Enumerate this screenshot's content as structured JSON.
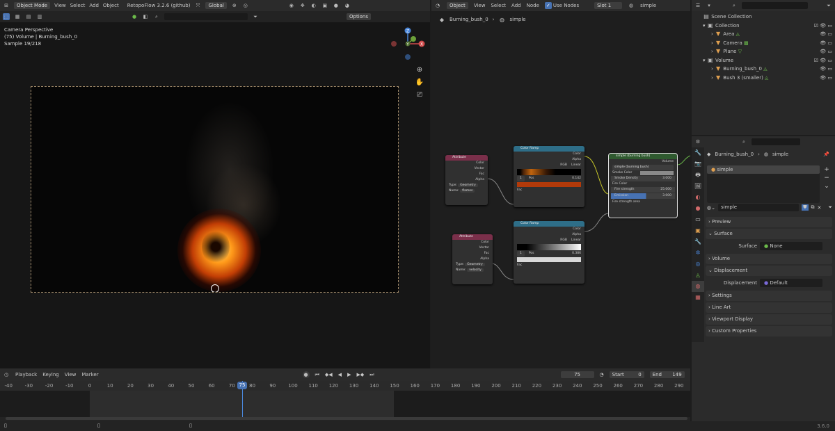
{
  "viewport": {
    "mode": "Object Mode",
    "menus": [
      "View",
      "Select",
      "Add",
      "Object"
    ],
    "addon": "RetopoFlow 3.2.6 (github)",
    "orientation": "Global",
    "options_label": "Options",
    "overlay_lines": [
      "Camera Perspective",
      "(75) Volume | Burning_bush_0",
      "Sample 19/218"
    ],
    "gizmo": {
      "z": "Z",
      "y": "Y",
      "x": "X"
    }
  },
  "node_editor": {
    "mode": "Object",
    "menus": [
      "View",
      "Select",
      "Add",
      "Node"
    ],
    "use_nodes": "Use Nodes",
    "slot": "Slot 1",
    "material": "simple",
    "breadcrumb": [
      "Burning_bush_0",
      "simple"
    ],
    "nodes": {
      "attr1": {
        "title": "Attribute",
        "outputs": [
          "Color",
          "Vector",
          "Fac",
          "Alpha"
        ],
        "type_label": "Type:",
        "type_value": "Geometry",
        "name_label": "Name:",
        "name_value": "flames"
      },
      "ramp1": {
        "title": "Color Ramp",
        "outputs": [
          "Color",
          "Alpha"
        ],
        "mode": "RGB",
        "interp": "Linear",
        "index": "1",
        "pos_label": "Pos",
        "pos_value": "0.142",
        "input": "Fac"
      },
      "attr2": {
        "title": "Attribute",
        "outputs": [
          "Color",
          "Vector",
          "Fac",
          "Alpha"
        ],
        "type_label": "Type:",
        "type_value": "Geometry",
        "name_label": "Name:",
        "name_value": "velocity"
      },
      "ramp2": {
        "title": "Color Ramp",
        "outputs": [
          "Color",
          "Alpha"
        ],
        "mode": "RGB",
        "interp": "Linear",
        "index": "1",
        "pos_label": "Pos",
        "pos_value": "0.386",
        "input": "Fac"
      },
      "group": {
        "title": "simple (burning bush)",
        "output": "Volume",
        "selector": "simple (burning bush)",
        "rows": [
          {
            "label": "Smoke Color",
            "value": ""
          },
          {
            "label": "Smoke Density",
            "value": "3.000"
          },
          {
            "label": "Fire Color",
            "value": ""
          },
          {
            "label": "Fire strength",
            "value": "25.000"
          },
          {
            "label": "Emission",
            "value": "3.000"
          },
          {
            "label": "Fire strength area",
            "value": ""
          }
        ]
      }
    }
  },
  "outliner": {
    "title": "Scene Collection",
    "items": [
      {
        "label": "Collection",
        "level": 1
      },
      {
        "label": "Area",
        "level": 2
      },
      {
        "label": "Camera",
        "level": 2
      },
      {
        "label": "Plane",
        "level": 2
      },
      {
        "label": "Volume",
        "level": 1
      },
      {
        "label": "Burning_bush_0",
        "level": 2
      },
      {
        "label": "Bush 3 (smaller)",
        "level": 2
      }
    ]
  },
  "properties": {
    "breadcrumb": [
      "Burning_bush_0",
      "simple"
    ],
    "slot_name": "simple",
    "material_name": "simple",
    "panels": [
      {
        "label": "Preview"
      },
      {
        "label": "Surface",
        "field_label": "Surface",
        "field_value": "None"
      },
      {
        "label": "Volume"
      },
      {
        "label": "Displacement",
        "field_label": "Displacement",
        "field_value": "Default"
      },
      {
        "label": "Settings"
      },
      {
        "label": "Line Art"
      },
      {
        "label": "Viewport Display"
      },
      {
        "label": "Custom Properties"
      }
    ]
  },
  "timeline": {
    "menus": [
      "Playback",
      "Keying",
      "View",
      "Marker"
    ],
    "current_frame": "75",
    "start_label": "Start",
    "start": "0",
    "end_label": "End",
    "end": "149",
    "ticks": [
      "-40",
      "-30",
      "-20",
      "-10",
      "0",
      "10",
      "20",
      "30",
      "40",
      "50",
      "60",
      "70",
      "75",
      "80",
      "90",
      "100",
      "110",
      "120",
      "130",
      "140",
      "150",
      "160",
      "170",
      "180",
      "190",
      "200",
      "210",
      "220",
      "230",
      "240",
      "250",
      "260",
      "270",
      "280",
      "290"
    ]
  },
  "status": {
    "version": "3.6.0"
  }
}
